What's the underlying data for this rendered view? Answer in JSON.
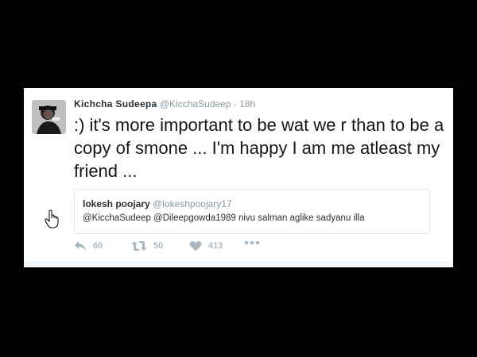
{
  "tweet": {
    "author_name": "Kichcha Sudeepa",
    "author_handle": "@KicchaSudeep",
    "separator": "·",
    "time": "18h",
    "text": ":) it's more important to be wat we r than to be a copy of smone ... I'm happy I am me atleast my friend ...",
    "avatar_icon": "profile-photo"
  },
  "quoted_tweet": {
    "author_name": "lokesh poojary",
    "author_handle": "@lokeshpoojary17",
    "text": "@KicchaSudeep @Dileepgowda1989 nivu salman aglike sadyanu illa"
  },
  "actions": {
    "reply_count": "60",
    "retweet_count": "50",
    "like_count": "413"
  },
  "colors": {
    "background": "#000000",
    "card": "#ffffff",
    "muted": "#8899a6",
    "icon": "#aab8c2"
  }
}
